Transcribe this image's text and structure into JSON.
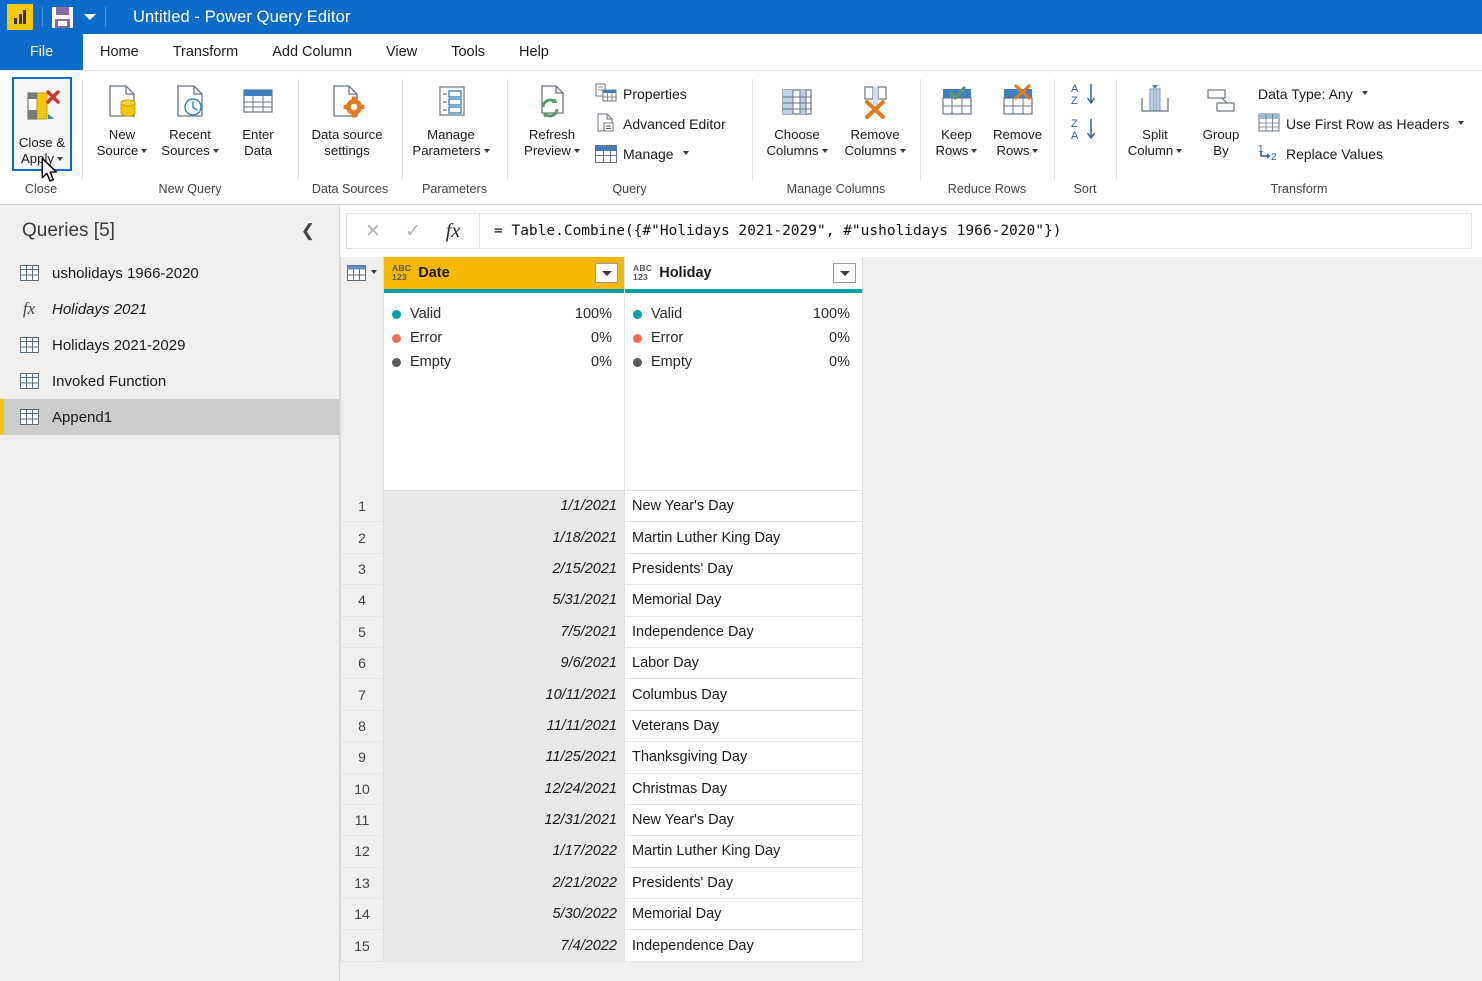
{
  "titlebar": {
    "app_icon": "power-bi-logo",
    "save_icon": "save-icon",
    "dropdown_icon": "chevron-down-icon",
    "title": "Untitled - Power Query Editor"
  },
  "tabs": {
    "file": "File",
    "items": [
      {
        "label": "Home",
        "active": true
      },
      {
        "label": "Transform",
        "active": false
      },
      {
        "label": "Add Column",
        "active": false
      },
      {
        "label": "View",
        "active": false
      },
      {
        "label": "Tools",
        "active": false
      },
      {
        "label": "Help",
        "active": false
      }
    ]
  },
  "ribbon": {
    "groups": [
      {
        "label": "Close"
      },
      {
        "label": "New Query"
      },
      {
        "label": "Data Sources"
      },
      {
        "label": "Parameters"
      },
      {
        "label": "Query"
      },
      {
        "label": "Manage Columns"
      },
      {
        "label": "Reduce Rows"
      },
      {
        "label": "Sort"
      },
      {
        "label": "Transform"
      }
    ],
    "close_apply": {
      "line1": "Close &",
      "line2": "Apply"
    },
    "new_source": {
      "line1": "New",
      "line2": "Source"
    },
    "recent_sources": {
      "line1": "Recent",
      "line2": "Sources"
    },
    "enter_data": {
      "line1": "Enter",
      "line2": "Data"
    },
    "data_source_settings": {
      "line1": "Data source",
      "line2": "settings"
    },
    "manage_parameters": {
      "line1": "Manage",
      "line2": "Parameters"
    },
    "refresh_preview": {
      "line1": "Refresh",
      "line2": "Preview"
    },
    "properties": "Properties",
    "advanced_editor": "Advanced Editor",
    "manage": "Manage",
    "choose_columns": {
      "line1": "Choose",
      "line2": "Columns"
    },
    "remove_columns": {
      "line1": "Remove",
      "line2": "Columns"
    },
    "keep_rows": {
      "line1": "Keep",
      "line2": "Rows"
    },
    "remove_rows": {
      "line1": "Remove",
      "line2": "Rows"
    },
    "sort_az": "A-Z",
    "sort_za": "Z-A",
    "split_column": {
      "line1": "Split",
      "line2": "Column"
    },
    "group_by": {
      "line1": "Group",
      "line2": "By"
    },
    "data_type": "Data Type: Any",
    "use_first_row_as_headers": "Use First Row as Headers",
    "replace_values": "Replace Values"
  },
  "sidebar": {
    "title": "Queries [5]",
    "collapse_icon": "chevron-left-icon",
    "items": [
      {
        "label": "usholidays 1966-2020",
        "icon": "table-icon",
        "kind": "table",
        "selected": false
      },
      {
        "label": "Holidays 2021",
        "icon": "fx-icon",
        "kind": "function",
        "selected": false
      },
      {
        "label": "Holidays 2021-2029",
        "icon": "table-icon",
        "kind": "table",
        "selected": false
      },
      {
        "label": "Invoked Function",
        "icon": "table-icon",
        "kind": "table",
        "selected": false
      },
      {
        "label": "Append1",
        "icon": "table-icon",
        "kind": "table",
        "selected": true
      }
    ]
  },
  "formula_bar": {
    "cancel_icon": "x-icon",
    "accept_icon": "check-icon",
    "fx_icon": "fx-icon",
    "value": "= Table.Combine({#\"Holidays 2021-2029\", #\"usholidays 1966-2020\"})"
  },
  "table": {
    "select_all_icon": "table-icon",
    "columns": [
      {
        "name": "Date",
        "type_icon": "ABC\n123",
        "type_line1": "ABC",
        "type_line2": "123",
        "selected": true
      },
      {
        "name": "Holiday",
        "type_icon": "ABC\n123",
        "type_line1": "ABC",
        "type_line2": "123",
        "selected": false
      }
    ],
    "quality": [
      {
        "column": "Date",
        "rows": [
          {
            "label": "Valid",
            "value": "100%",
            "status": "valid"
          },
          {
            "label": "Error",
            "value": "0%",
            "status": "error"
          },
          {
            "label": "Empty",
            "value": "0%",
            "status": "empty"
          }
        ]
      },
      {
        "column": "Holiday",
        "rows": [
          {
            "label": "Valid",
            "value": "100%",
            "status": "valid"
          },
          {
            "label": "Error",
            "value": "0%",
            "status": "error"
          },
          {
            "label": "Empty",
            "value": "0%",
            "status": "empty"
          }
        ]
      }
    ],
    "rows": [
      {
        "n": "1",
        "date": "1/1/2021",
        "holiday": "New Year's Day"
      },
      {
        "n": "2",
        "date": "1/18/2021",
        "holiday": "Martin Luther King Day"
      },
      {
        "n": "3",
        "date": "2/15/2021",
        "holiday": "Presidents' Day"
      },
      {
        "n": "4",
        "date": "5/31/2021",
        "holiday": "Memorial Day"
      },
      {
        "n": "5",
        "date": "7/5/2021",
        "holiday": "Independence Day"
      },
      {
        "n": "6",
        "date": "9/6/2021",
        "holiday": "Labor Day"
      },
      {
        "n": "7",
        "date": "10/11/2021",
        "holiday": "Columbus Day"
      },
      {
        "n": "8",
        "date": "11/11/2021",
        "holiday": "Veterans Day"
      },
      {
        "n": "9",
        "date": "11/25/2021",
        "holiday": "Thanksgiving Day"
      },
      {
        "n": "10",
        "date": "12/24/2021",
        "holiday": "Christmas Day"
      },
      {
        "n": "11",
        "date": "12/31/2021",
        "holiday": "New Year's Day"
      },
      {
        "n": "12",
        "date": "1/17/2022",
        "holiday": "Martin Luther King Day"
      },
      {
        "n": "13",
        "date": "2/21/2022",
        "holiday": "Presidents' Day"
      },
      {
        "n": "14",
        "date": "5/30/2022",
        "holiday": "Memorial Day"
      },
      {
        "n": "15",
        "date": "7/4/2022",
        "holiday": "Independence Day"
      }
    ]
  },
  "colors": {
    "title_bar": "#0b6bc8",
    "selected_column_header": "#f5b800",
    "quality_valid": "#00a0a8",
    "quality_error": "#f26b5b",
    "quality_empty": "#595959",
    "selection_border": "#0b6bc8",
    "query_selected_accent": "#f2c811",
    "panel_background": "#f0efed"
  }
}
